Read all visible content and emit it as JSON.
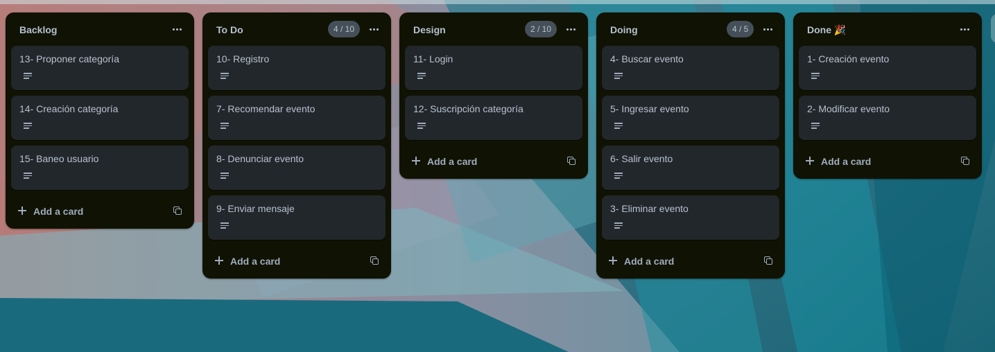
{
  "board": {
    "lists": [
      {
        "title": "Backlog",
        "count": "",
        "cards": [
          {
            "title": "13- Proponer categoría"
          },
          {
            "title": "14- Creación categoría"
          },
          {
            "title": "15- Baneo usuario"
          }
        ],
        "add_label": "Add a card"
      },
      {
        "title": "To Do",
        "count": "4 / 10",
        "cards": [
          {
            "title": "10- Registro"
          },
          {
            "title": "7- Recomendar evento"
          },
          {
            "title": "8- Denunciar evento"
          },
          {
            "title": "9- Enviar mensaje"
          }
        ],
        "add_label": "Add a card"
      },
      {
        "title": "Design",
        "count": "2 / 10",
        "cards": [
          {
            "title": "11- Login"
          },
          {
            "title": "12- Suscripción categoría"
          }
        ],
        "add_label": "Add a card"
      },
      {
        "title": "Doing",
        "count": "4 / 5",
        "cards": [
          {
            "title": "4- Buscar evento"
          },
          {
            "title": "5- Ingresar evento"
          },
          {
            "title": "6- Salir evento"
          },
          {
            "title": "3- Eliminar evento"
          }
        ],
        "add_label": "Add a card"
      },
      {
        "title": "Done 🎉",
        "count": "",
        "cards": [
          {
            "title": "1- Creación evento"
          },
          {
            "title": "2- Modificar evento"
          }
        ],
        "add_label": "Add a card"
      }
    ]
  },
  "theme": {
    "list_bg": "#101204",
    "card_bg": "#22272b",
    "text": "#b6c2cf",
    "muted_text": "#9fadbc",
    "badge_bg": "#454f59"
  }
}
